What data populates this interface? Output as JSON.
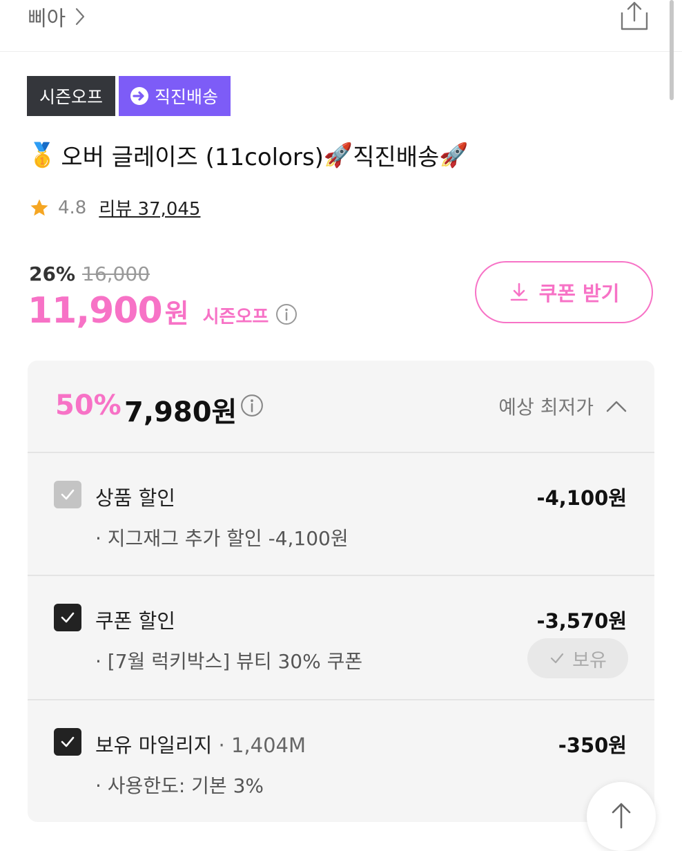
{
  "header": {
    "store_name": "삐아"
  },
  "badges": {
    "season_off": "시즌오프",
    "direct_delivery": "직진배송"
  },
  "product": {
    "medal_emoji": "🥇",
    "title_text": "오버 글레이즈 (11colors) ",
    "rocket_emoji": "🚀",
    "title_suffix": "직진배송"
  },
  "rating": {
    "score": "4.8",
    "review_label": "리뷰 37,045"
  },
  "price": {
    "discount_pct": "26%",
    "original": "16,000",
    "sale": "11,900",
    "won": "원",
    "tag": "시즌오프"
  },
  "coupon_button": {
    "label": "쿠폰 받기"
  },
  "best_price": {
    "pct": "50%",
    "value": "7,980원",
    "label": "예상 최저가"
  },
  "sections": [
    {
      "label": "상품 할인",
      "sub": "",
      "amount": "-4,100원",
      "detail": "· 지그재그 추가 할인 -4,100원",
      "checked": true,
      "disabled": true
    },
    {
      "label": "쿠폰 할인",
      "sub": "",
      "amount": "-3,570원",
      "detail": "· [7월 럭키박스] 뷰티 30% 쿠폰",
      "checked": true,
      "hold_label": "보유"
    },
    {
      "label": "보유 마일리지",
      "sub": " · 1,404M",
      "amount": "-350원",
      "detail": "· 사용한도: 기본 3%",
      "checked": true
    }
  ],
  "colors": {
    "accent_pink": "#f772c6",
    "purple": "#7d5cf7",
    "dark_badge": "#34363b"
  }
}
